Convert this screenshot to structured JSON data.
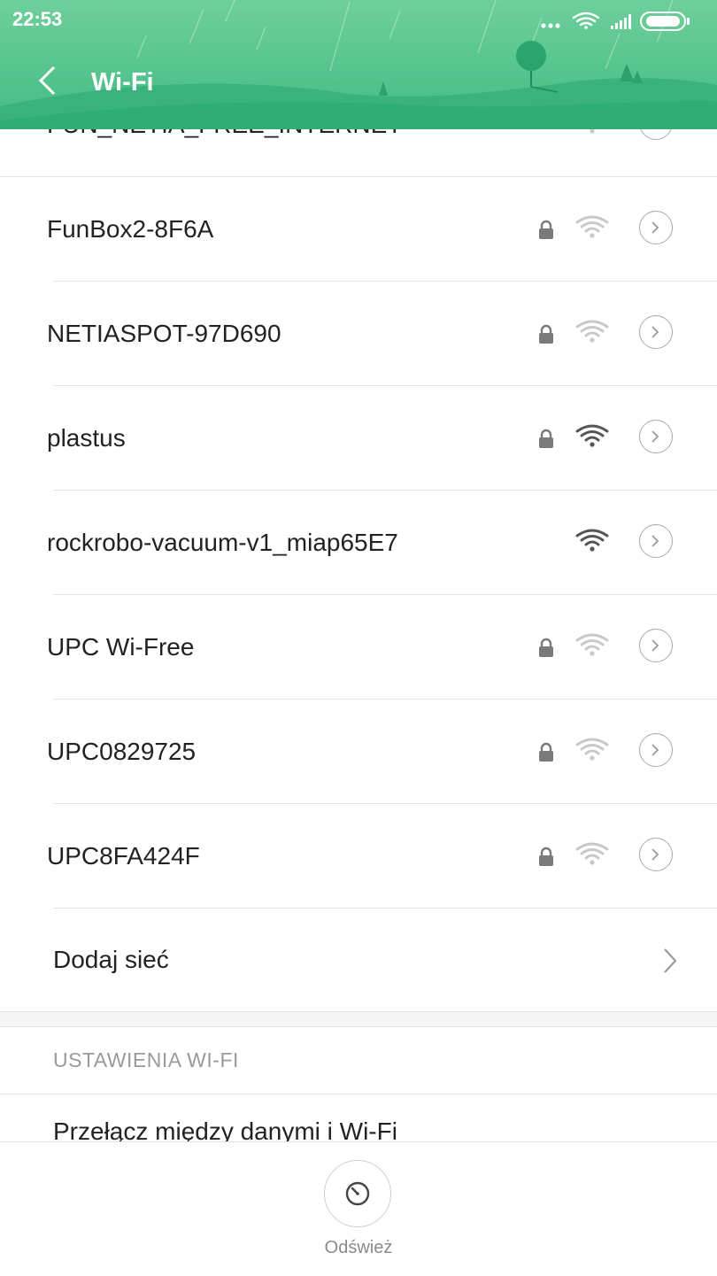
{
  "status_bar": {
    "time": "22:53",
    "icons": [
      "more-dots-icon",
      "wifi-status-icon",
      "cellular-signal-icon",
      "battery-icon"
    ]
  },
  "header": {
    "title": "Wi-Fi",
    "back_icon": "back-arrow-icon"
  },
  "networks": [
    {
      "ssid": "FUN_NETIA_FREE_INTERNET",
      "secured": false,
      "signal": "weak"
    },
    {
      "ssid": "FunBox2-8F6A",
      "secured": true,
      "signal": "weak"
    },
    {
      "ssid": "NETIASPOT-97D690",
      "secured": true,
      "signal": "weak"
    },
    {
      "ssid": "plastus",
      "secured": true,
      "signal": "strong"
    },
    {
      "ssid": "rockrobo-vacuum-v1_miap65E7",
      "secured": false,
      "signal": "strong"
    },
    {
      "ssid": "UPC Wi-Free",
      "secured": true,
      "signal": "weak"
    },
    {
      "ssid": "UPC0829725",
      "secured": true,
      "signal": "weak"
    },
    {
      "ssid": "UPC8FA424F",
      "secured": true,
      "signal": "weak"
    }
  ],
  "add_network": {
    "label": "Dodaj sieć"
  },
  "settings": {
    "section_title": "USTAWIENIA WI-FI",
    "items": [
      {
        "label": "Przełącz między danymi i Wi-Fi"
      }
    ]
  },
  "bottom": {
    "refresh_label": "Odśwież",
    "refresh_icon": "refresh-icon"
  },
  "colors": {
    "header_green": "#42bb83",
    "header_light": "#6fcf9b",
    "icon_strong": "#555555",
    "icon_weak": "#c8c8c8"
  }
}
